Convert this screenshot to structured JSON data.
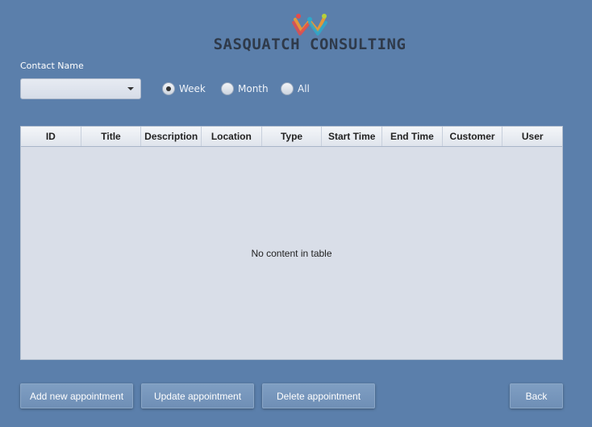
{
  "header": {
    "brand": "SASQUATCH CONSULTING"
  },
  "filters": {
    "contact_label": "Contact Name",
    "contact_value": "",
    "radios": [
      {
        "label": "Week",
        "selected": true
      },
      {
        "label": "Month",
        "selected": false
      },
      {
        "label": "All",
        "selected": false
      }
    ]
  },
  "table": {
    "columns": [
      "ID",
      "Title",
      "Description",
      "Location",
      "Type",
      "Start Time",
      "End Time",
      "Customer",
      "User"
    ],
    "empty_text": "No content in table"
  },
  "actions": {
    "add": "Add new appointment",
    "update": "Update appointment",
    "delete": "Delete appointment",
    "back": "Back"
  },
  "colors": {
    "background": "#5b7fab",
    "button": "#7f9ec2",
    "table": "#d9dee8"
  },
  "icons": {
    "logo": "sasquatch-logo",
    "dropdown": "chevron-down-icon"
  }
}
